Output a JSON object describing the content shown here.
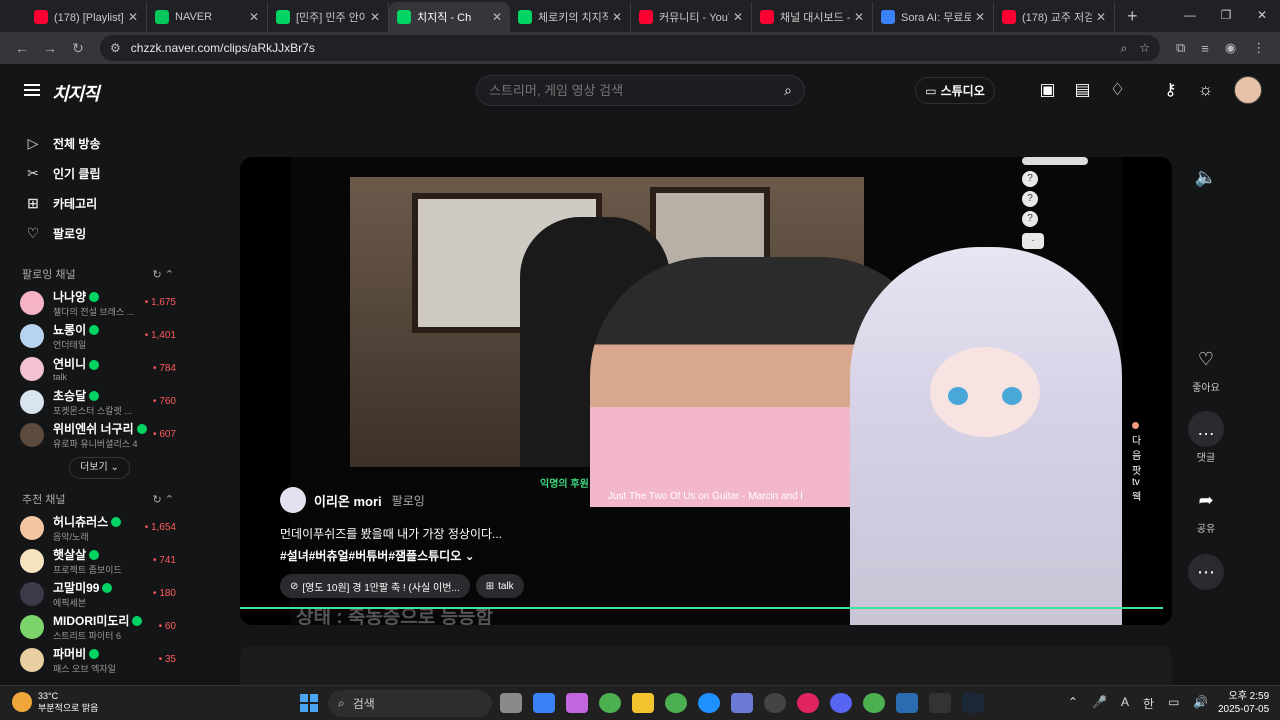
{
  "browser": {
    "tabs": [
      {
        "title": "(178) [Playlist] 여",
        "color": "#ff0033",
        "active": false
      },
      {
        "title": "NAVER",
        "color": "#03c75a",
        "active": false
      },
      {
        "title": "[민주] 민주 안아",
        "color": "#00d564",
        "active": false
      },
      {
        "title": "치지직 - Ch",
        "color": "#00d564",
        "active": true
      },
      {
        "title": "체로키의 치지직",
        "color": "#00d564",
        "active": false
      },
      {
        "title": "커뮤니티 - YouT",
        "color": "#ff0033",
        "active": false
      },
      {
        "title": "채널 대시보드 -",
        "color": "#ff0033",
        "active": false
      },
      {
        "title": "Sora AI: 무료로",
        "color": "#3b82f6",
        "active": false
      },
      {
        "title": "(178) 교주 저검",
        "color": "#ff0033",
        "active": false
      }
    ],
    "url": "chzzk.naver.com/clips/aRkJJxBr7s"
  },
  "header": {
    "logo": "치지직",
    "search_placeholder": "스트리머, 게임 영상 검색",
    "studio_label": "스튜디오"
  },
  "sidebar": {
    "menu": [
      {
        "label": "전체 방송",
        "icon": "play-square-icon"
      },
      {
        "label": "인기 클립",
        "icon": "scissors-icon"
      },
      {
        "label": "카테고리",
        "icon": "grid-icon"
      },
      {
        "label": "팔로잉",
        "icon": "heart-icon"
      }
    ],
    "following_title": "팔로잉 채널",
    "following": [
      {
        "name": "나나양",
        "sub": "젤다의 전설 브레스 ...",
        "count": "1,675",
        "color": "#f6b3c6"
      },
      {
        "name": "뇨롱이",
        "sub": "언더테일",
        "count": "1,401",
        "color": "#b7d3f2"
      },
      {
        "name": "연비니",
        "sub": "talk",
        "count": "784",
        "color": "#f3c1d0"
      },
      {
        "name": "초승달",
        "sub": "포켓몬스터 스칼렛 ...",
        "count": "760",
        "color": "#d9e4ef"
      },
      {
        "name": "위비엔쉬 너구리",
        "sub": "유로파 유니버셜리스 4",
        "count": "607",
        "color": "#5b4a3e"
      }
    ],
    "more_label": "더보기",
    "recommended_title": "추천 채널",
    "recommended": [
      {
        "name": "허니츄러스",
        "sub": "음악/노래",
        "count": "1,654",
        "color": "#f2c6a0"
      },
      {
        "name": "햇살살",
        "sub": "프로젝트 좀보이드",
        "count": "741",
        "color": "#f7e2c0"
      },
      {
        "name": "고말미99",
        "sub": "에픽세븐",
        "count": "180",
        "color": "#3a3a4a"
      },
      {
        "name": "MIDORI미도리",
        "sub": "스트리트 파이터 6",
        "count": "60",
        "color": "#7ad36b"
      },
      {
        "name": "파머비",
        "sub": "패스 오브 엑자일",
        "count": "35",
        "color": "#e7cfa1"
      }
    ]
  },
  "clip": {
    "owner_name": "이리온 mori",
    "follow_label": "팔로잉",
    "description": "먼데이푸쉬즈를 봤을때 내가 가장 정상이다...",
    "tags": "#설녀#버츄얼#버튜버#잼플스튜디오",
    "chip_1": "[영도 10원] 경 1만팔 축 ! (사실 이번...",
    "chip_2": "talk",
    "video_caption_green": "익명의 후원",
    "video_caption_white": "Just The Two Of Us on Guitar - Marcin and l",
    "chat_line": "다음팟tv 웩",
    "status_text": "상태 : 축농증으로 능능함",
    "progress": 0.99
  },
  "actions": {
    "like": "좋아요",
    "comment": "댓글",
    "share": "공유"
  },
  "taskbar": {
    "temp": "33°C",
    "weather": "부분적으로 맑음",
    "search": "검색",
    "ime": "한",
    "time": "오후 2:59",
    "date": "2025-07-05"
  }
}
